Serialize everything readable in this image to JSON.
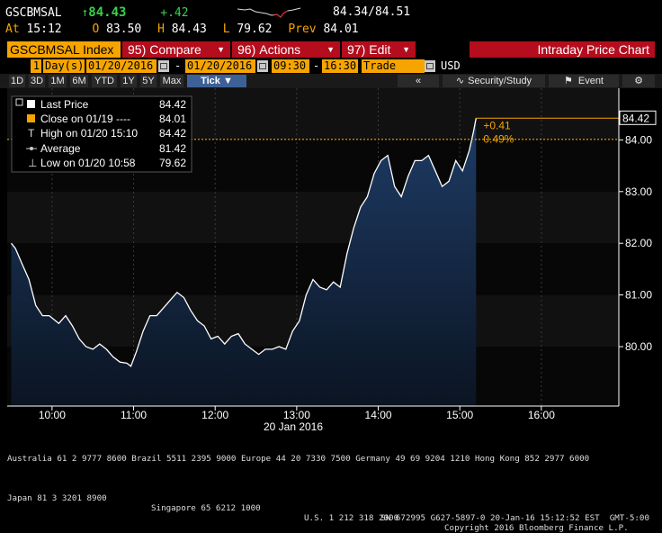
{
  "header": {
    "ticker": "GSCBMSAL",
    "arrow": "↑",
    "last": "84.43",
    "change": "+.42",
    "bid_ask": "84.34/84.51",
    "at_label": "At",
    "time": "15:12",
    "open_label": "O",
    "open": "83.50",
    "high_label": "H",
    "high": "84.43",
    "low_label": "L",
    "low": "79.62",
    "prev_label": "Prev",
    "prev": "84.01"
  },
  "menubar": {
    "index_label": "GSCBMSAL Index",
    "compare_num": "95)",
    "compare": "Compare",
    "actions_num": "96)",
    "actions": "Actions",
    "edit_num": "97)",
    "edit": "Edit",
    "title": "Intraday Price Chart"
  },
  "daterow": {
    "period_count": "1",
    "period_unit": "Day(s)",
    "start_date": "01/20/2016",
    "end_date": "01/20/2016",
    "start_time": "09:30",
    "end_time": "16:30",
    "mode": "Trade",
    "currency": "USD"
  },
  "tabs": [
    "1D",
    "3D",
    "1M",
    "6M",
    "YTD",
    "1Y",
    "5Y",
    "Max",
    "Tick ▼"
  ],
  "active_tab": "Tick ▼",
  "toolbar": {
    "collapse": "«",
    "security_study": "Security/Study",
    "event": "Event",
    "settings": "⚙"
  },
  "legend": [
    {
      "label": "Last Price",
      "value": "84.42"
    },
    {
      "label": "Close on 01/19 ---- ",
      "value": "84.01"
    },
    {
      "label": "High on 01/20 15:10",
      "value": "84.42"
    },
    {
      "label": "Average",
      "value": "81.42"
    },
    {
      "label": "Low on 01/20 10:58",
      "value": "79.62"
    }
  ],
  "chart_data": {
    "type": "area",
    "x_ticks": [
      "10:00",
      "11:00",
      "12:00",
      "13:00",
      "14:00",
      "15:00",
      "16:00"
    ],
    "date_label": "20 Jan 2016",
    "y_ticks": [
      "80.00",
      "81.00",
      "82.00",
      "83.00",
      "84.00"
    ],
    "ylim": [
      78.85,
      85.0
    ],
    "x": [
      "09:30",
      "09:33",
      "09:38",
      "09:43",
      "09:48",
      "09:53",
      "09:58",
      "10:05",
      "10:10",
      "10:15",
      "10:20",
      "10:25",
      "10:30",
      "10:35",
      "10:40",
      "10:45",
      "10:50",
      "10:55",
      "10:58",
      "11:02",
      "11:07",
      "11:12",
      "11:17",
      "11:22",
      "11:27",
      "11:32",
      "11:37",
      "11:42",
      "11:47",
      "11:52",
      "11:57",
      "12:02",
      "12:07",
      "12:12",
      "12:17",
      "12:22",
      "12:27",
      "12:32",
      "12:37",
      "12:42",
      "12:47",
      "12:52",
      "12:57",
      "13:02",
      "13:07",
      "13:12",
      "13:17",
      "13:22",
      "13:27",
      "13:32",
      "13:37",
      "13:42",
      "13:47",
      "13:52",
      "13:57",
      "14:02",
      "14:07",
      "14:12",
      "14:17",
      "14:22",
      "14:27",
      "14:32",
      "14:37",
      "14:42",
      "14:47",
      "14:52",
      "14:57",
      "15:02",
      "15:07",
      "15:10",
      "15:12"
    ],
    "values": [
      82.0,
      81.9,
      81.6,
      81.3,
      80.8,
      80.6,
      80.6,
      80.45,
      80.6,
      80.4,
      80.15,
      80.0,
      79.95,
      80.05,
      79.95,
      79.8,
      79.7,
      79.68,
      79.62,
      79.9,
      80.3,
      80.6,
      80.6,
      80.75,
      80.9,
      81.05,
      80.95,
      80.7,
      80.5,
      80.4,
      80.15,
      80.2,
      80.05,
      80.2,
      80.25,
      80.05,
      79.95,
      79.85,
      79.95,
      79.95,
      80.0,
      79.95,
      80.3,
      80.5,
      81.0,
      81.3,
      81.15,
      81.1,
      81.25,
      81.15,
      81.8,
      82.3,
      82.7,
      82.9,
      83.35,
      83.6,
      83.7,
      83.1,
      82.9,
      83.3,
      83.6,
      83.6,
      83.7,
      83.4,
      83.1,
      83.2,
      83.6,
      83.4,
      83.8,
      84.15,
      84.42
    ],
    "close_ref": 84.01,
    "last": 84.42,
    "annotation_change": "+0.41",
    "annotation_pct": "0.49%",
    "colors": {
      "area_top": "#1e3c66",
      "area_bottom": "#0b1422",
      "line": "#ffffff",
      "close": "#f6a400",
      "axis": "#ffffff"
    }
  },
  "footer": {
    "line1": "Australia 61 2 9777 8600 Brazil 5511 2395 9000 Europe 44 20 7330 7500 Germany 49 69 9204 1210 Hong Kong 852 2977 6000",
    "line2_left": "Japan 81 3 3201 8900",
    "line2_mid1": "Singapore 65 6212 1000",
    "line2_mid2": "U.S. 1 212 318 2000",
    "line2_right": "Copyright 2016 Bloomberg Finance L.P.",
    "line3": "SN 672995 G627-5897-0 20-Jan-16 15:12:52 EST  GMT-5:00"
  }
}
